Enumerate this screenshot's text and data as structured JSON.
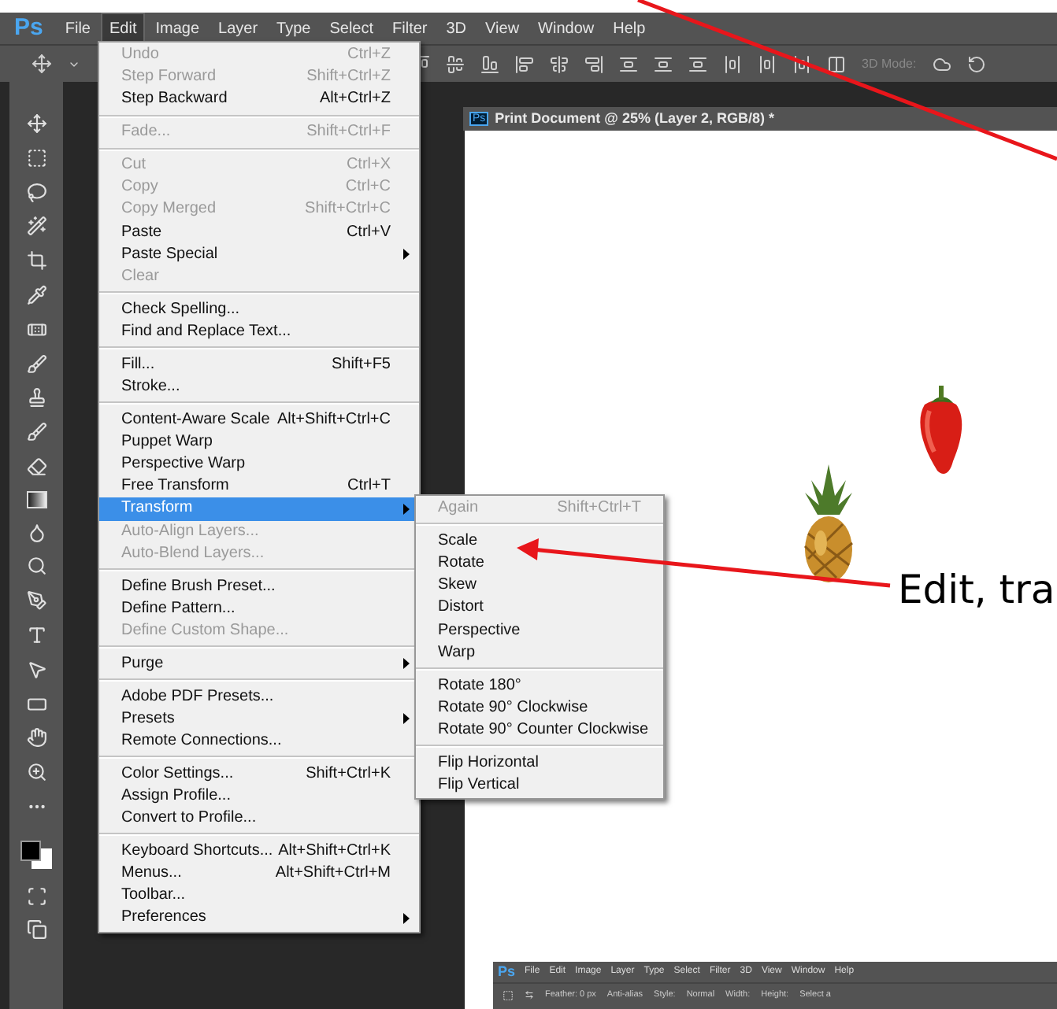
{
  "menu_bar": {
    "logo": "Ps",
    "items": [
      {
        "label": "File",
        "selected": false
      },
      {
        "label": "Edit",
        "selected": true
      },
      {
        "label": "Image",
        "selected": false
      },
      {
        "label": "Layer",
        "selected": false
      },
      {
        "label": "Type",
        "selected": false
      },
      {
        "label": "Select",
        "selected": false
      },
      {
        "label": "Filter",
        "selected": false
      },
      {
        "label": "3D",
        "selected": false
      },
      {
        "label": "View",
        "selected": false
      },
      {
        "label": "Window",
        "selected": false
      },
      {
        "label": "Help",
        "selected": false
      }
    ]
  },
  "options_bar": {
    "mode_label": "3D Mode:"
  },
  "edit_menu": {
    "groups": [
      [
        {
          "label": "Undo",
          "shortcut": "Ctrl+Z",
          "disabled": true,
          "submenu": false,
          "selected": false
        },
        {
          "label": "Step Forward",
          "shortcut": "Shift+Ctrl+Z",
          "disabled": true,
          "submenu": false,
          "selected": false
        },
        {
          "label": "Step Backward",
          "shortcut": "Alt+Ctrl+Z",
          "disabled": false,
          "submenu": false,
          "selected": false
        }
      ],
      [
        {
          "label": "Fade...",
          "shortcut": "Shift+Ctrl+F",
          "disabled": true,
          "submenu": false,
          "selected": false
        }
      ],
      [
        {
          "label": "Cut",
          "shortcut": "Ctrl+X",
          "disabled": true,
          "submenu": false,
          "selected": false
        },
        {
          "label": "Copy",
          "shortcut": "Ctrl+C",
          "disabled": true,
          "submenu": false,
          "selected": false
        },
        {
          "label": "Copy Merged",
          "shortcut": "Shift+Ctrl+C",
          "disabled": true,
          "submenu": false,
          "selected": false
        },
        {
          "label": "Paste",
          "shortcut": "Ctrl+V",
          "disabled": false,
          "submenu": false,
          "selected": false
        },
        {
          "label": "Paste Special",
          "disabled": false,
          "submenu": true,
          "selected": false
        },
        {
          "label": "Clear",
          "disabled": true,
          "submenu": false,
          "selected": false
        }
      ],
      [
        {
          "label": "Check Spelling...",
          "disabled": false,
          "submenu": false,
          "selected": false
        },
        {
          "label": "Find and Replace Text...",
          "disabled": false,
          "submenu": false,
          "selected": false
        }
      ],
      [
        {
          "label": "Fill...",
          "shortcut": "Shift+F5",
          "disabled": false,
          "submenu": false,
          "selected": false
        },
        {
          "label": "Stroke...",
          "disabled": false,
          "submenu": false,
          "selected": false
        }
      ],
      [
        {
          "label": "Content-Aware Scale",
          "shortcut": "Alt+Shift+Ctrl+C",
          "disabled": false,
          "submenu": false,
          "selected": false
        },
        {
          "label": "Puppet Warp",
          "disabled": false,
          "submenu": false,
          "selected": false
        },
        {
          "label": "Perspective Warp",
          "disabled": false,
          "submenu": false,
          "selected": false
        },
        {
          "label": "Free Transform",
          "shortcut": "Ctrl+T",
          "disabled": false,
          "submenu": false,
          "selected": false
        },
        {
          "label": "Transform",
          "disabled": false,
          "submenu": true,
          "selected": true
        },
        {
          "label": "Auto-Align Layers...",
          "disabled": true,
          "submenu": false,
          "selected": false
        },
        {
          "label": "Auto-Blend Layers...",
          "disabled": true,
          "submenu": false,
          "selected": false
        }
      ],
      [
        {
          "label": "Define Brush Preset...",
          "disabled": false,
          "submenu": false,
          "selected": false
        },
        {
          "label": "Define Pattern...",
          "disabled": false,
          "submenu": false,
          "selected": false
        },
        {
          "label": "Define Custom Shape...",
          "disabled": true,
          "submenu": false,
          "selected": false
        }
      ],
      [
        {
          "label": "Purge",
          "disabled": false,
          "submenu": true,
          "selected": false
        }
      ],
      [
        {
          "label": "Adobe PDF Presets...",
          "disabled": false,
          "submenu": false,
          "selected": false
        },
        {
          "label": "Presets",
          "disabled": false,
          "submenu": true,
          "selected": false
        },
        {
          "label": "Remote Connections...",
          "disabled": false,
          "submenu": false,
          "selected": false
        }
      ],
      [
        {
          "label": "Color Settings...",
          "shortcut": "Shift+Ctrl+K",
          "disabled": false,
          "submenu": false,
          "selected": false
        },
        {
          "label": "Assign Profile...",
          "disabled": false,
          "submenu": false,
          "selected": false
        },
        {
          "label": "Convert to Profile...",
          "disabled": false,
          "submenu": false,
          "selected": false
        }
      ],
      [
        {
          "label": "Keyboard Shortcuts...",
          "shortcut": "Alt+Shift+Ctrl+K",
          "disabled": false,
          "submenu": false,
          "selected": false
        },
        {
          "label": "Menus...",
          "shortcut": "Alt+Shift+Ctrl+M",
          "disabled": false,
          "submenu": false,
          "selected": false
        },
        {
          "label": "Toolbar...",
          "disabled": false,
          "submenu": false,
          "selected": false
        },
        {
          "label": "Preferences",
          "disabled": false,
          "submenu": true,
          "selected": false
        }
      ]
    ]
  },
  "transform_submenu": {
    "groups": [
      [
        {
          "label": "Again",
          "shortcut": "Shift+Ctrl+T",
          "disabled": true
        }
      ],
      [
        {
          "label": "Scale",
          "disabled": false
        },
        {
          "label": "Rotate",
          "disabled": false
        },
        {
          "label": "Skew",
          "disabled": false
        },
        {
          "label": "Distort",
          "disabled": false
        },
        {
          "label": "Perspective",
          "disabled": false
        },
        {
          "label": "Warp",
          "disabled": false
        }
      ],
      [
        {
          "label": "Rotate 180°",
          "disabled": false
        },
        {
          "label": "Rotate 90° Clockwise",
          "disabled": false
        },
        {
          "label": "Rotate 90° Counter Clockwise",
          "disabled": false
        }
      ],
      [
        {
          "label": "Flip Horizontal",
          "disabled": false
        },
        {
          "label": "Flip Vertical",
          "disabled": false
        }
      ]
    ]
  },
  "document": {
    "icon": "Ps",
    "title": "Print Document @ 25% (Layer 2, RGB/8) *"
  },
  "annotation": {
    "text": "Edit, tra"
  },
  "embedded_screenshot": {
    "logo": "Ps",
    "menu_items": [
      "File",
      "Edit",
      "Image",
      "Layer",
      "Type",
      "Select",
      "Filter",
      "3D",
      "View",
      "Window",
      "Help"
    ],
    "options": [
      "Feather: 0 px",
      "Anti-alias",
      "Style:",
      "Normal",
      "Width:",
      "Height:",
      "Select a"
    ]
  }
}
